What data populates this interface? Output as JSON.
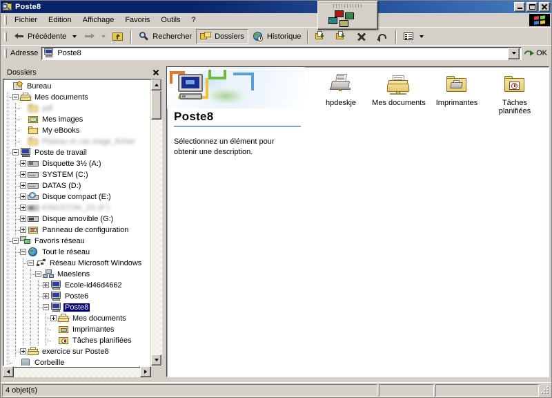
{
  "window": {
    "title": "Poste8",
    "icon": "search-folder-icon",
    "controls": {
      "minimize": "_",
      "maximize": "□",
      "close": "×"
    }
  },
  "menubar": {
    "items": [
      {
        "label": "Fichier",
        "accel": "F"
      },
      {
        "label": "Edition",
        "accel": "E"
      },
      {
        "label": "Affichage",
        "accel": "A"
      },
      {
        "label": "Favoris",
        "accel": "v"
      },
      {
        "label": "Outils",
        "accel": "O"
      },
      {
        "label": "?",
        "accel": ""
      }
    ],
    "logo": "windows-flag-logo"
  },
  "toolbar": {
    "back_label": "Précédente",
    "forward_label": "",
    "up_label": "",
    "search_label": "Rechercher",
    "folders_label": "Dossiers",
    "history_label": "Historique",
    "move_to_label": "",
    "copy_to_label": "",
    "delete_label": "",
    "undo_label": "",
    "views_label": ""
  },
  "address": {
    "label": "Adresse",
    "value": "Poste8",
    "icon": "computer-icon",
    "go_label": "OK"
  },
  "folders_pane": {
    "header": "Dossiers",
    "tree": [
      {
        "label": "Bureau",
        "indent": 0,
        "icon": "desktop-icon",
        "expander": "none",
        "selected": false,
        "blurred": false
      },
      {
        "label": "Mes documents",
        "indent": 1,
        "icon": "my-documents-icon",
        "expander": "minus",
        "selected": false,
        "blurred": false
      },
      {
        "label": "pdf",
        "indent": 2,
        "icon": "folder-icon",
        "expander": "none",
        "selected": false,
        "blurred": true
      },
      {
        "label": "Mes images",
        "indent": 2,
        "icon": "my-pictures-icon",
        "expander": "none",
        "selected": false,
        "blurred": false
      },
      {
        "label": "My eBooks",
        "indent": 2,
        "icon": "folder-icon",
        "expander": "none",
        "selected": false,
        "blurred": false
      },
      {
        "label": "Plateau et cas stage_fichier",
        "indent": 2,
        "icon": "folder-icon",
        "expander": "none",
        "selected": false,
        "blurred": true
      },
      {
        "label": "Poste de travail",
        "indent": 1,
        "icon": "my-computer-icon",
        "expander": "minus",
        "selected": false,
        "blurred": false
      },
      {
        "label": "Disquette 3½ (A:)",
        "indent": 2,
        "icon": "floppy-icon",
        "expander": "plus",
        "selected": false,
        "blurred": false
      },
      {
        "label": "SYSTEM (C:)",
        "indent": 2,
        "icon": "harddisk-icon",
        "expander": "plus",
        "selected": false,
        "blurred": false
      },
      {
        "label": "DATAS (D:)",
        "indent": 2,
        "icon": "harddisk-icon",
        "expander": "plus",
        "selected": false,
        "blurred": false
      },
      {
        "label": "Disque compact (E:)",
        "indent": 2,
        "icon": "cdrom-icon",
        "expander": "plus",
        "selected": false,
        "blurred": false
      },
      {
        "label": "KINGSTON_2G (F:)",
        "indent": 2,
        "icon": "removable-icon",
        "expander": "plus",
        "selected": false,
        "blurred": true
      },
      {
        "label": "Disque amovible (G:)",
        "indent": 2,
        "icon": "removable-icon",
        "expander": "plus",
        "selected": false,
        "blurred": false
      },
      {
        "label": "Panneau de configuration",
        "indent": 2,
        "icon": "control-panel-icon",
        "expander": "plus",
        "selected": false,
        "blurred": false
      },
      {
        "label": "Favoris réseau",
        "indent": 1,
        "icon": "network-places-icon",
        "expander": "minus",
        "selected": false,
        "blurred": false
      },
      {
        "label": "Tout le réseau",
        "indent": 2,
        "icon": "globe-icon",
        "expander": "minus",
        "selected": false,
        "blurred": false
      },
      {
        "label": "Réseau Microsoft Windows",
        "indent": 3,
        "icon": "network-icon",
        "expander": "minus",
        "selected": false,
        "blurred": false
      },
      {
        "label": "Maeslens",
        "indent": 4,
        "icon": "workgroup-icon",
        "expander": "minus",
        "selected": false,
        "blurred": false
      },
      {
        "label": "Ecole-id46d4662",
        "indent": 5,
        "icon": "computer-icon",
        "expander": "plus",
        "selected": false,
        "blurred": false
      },
      {
        "label": "Poste6",
        "indent": 5,
        "icon": "computer-icon",
        "expander": "plus",
        "selected": false,
        "blurred": false
      },
      {
        "label": "Poste8",
        "indent": 5,
        "icon": "computer-icon",
        "expander": "minus",
        "selected": true,
        "blurred": false
      },
      {
        "label": "Mes documents",
        "indent": 6,
        "icon": "my-documents-icon",
        "expander": "plus",
        "selected": false,
        "blurred": false
      },
      {
        "label": "Imprimantes",
        "indent": 6,
        "icon": "printers-folder-icon",
        "expander": "none",
        "selected": false,
        "blurred": false
      },
      {
        "label": "Tâches planifiées",
        "indent": 6,
        "icon": "scheduled-tasks-icon",
        "expander": "none",
        "selected": false,
        "blurred": false
      },
      {
        "label": "exercice sur Poste8",
        "indent": 2,
        "icon": "my-documents-icon",
        "expander": "plus",
        "selected": false,
        "blurred": false
      },
      {
        "label": "Corbeille",
        "indent": 1,
        "icon": "recycle-bin-icon",
        "expander": "none",
        "selected": false,
        "blurred": false
      }
    ]
  },
  "webview": {
    "title": "Poste8",
    "description": "Sélectionnez un élément pour obtenir une description."
  },
  "items": [
    {
      "label": "hpdeskje",
      "icon": "printer-icon"
    },
    {
      "label": "Mes documents",
      "icon": "my-documents-folder-icon"
    },
    {
      "label": "Imprimantes",
      "icon": "printers-folder-icon"
    },
    {
      "label": "Tâches planifiées",
      "icon": "scheduled-tasks-folder-icon"
    }
  ],
  "statusbar": {
    "object_count": "4 objet(s)",
    "panel2": "",
    "panel3": "",
    "panel4": ""
  },
  "palette": {
    "name": "floating-color-palette",
    "swatches": [
      "#b01818",
      "#2f8a46",
      "#1f8a8a",
      "#b3b06a"
    ]
  }
}
